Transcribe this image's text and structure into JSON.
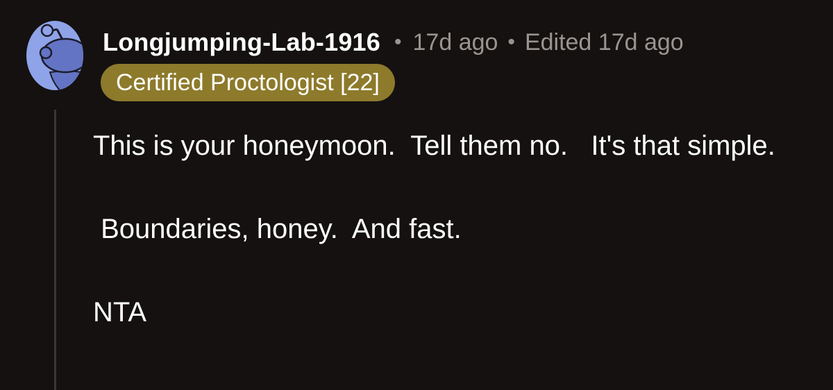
{
  "comment": {
    "username": "Longjumping-Lab-1916",
    "separator": "•",
    "timestamp": "17d ago",
    "edited": "Edited 17d ago",
    "flair": "Certified Proctologist [22]",
    "paragraphs": [
      "This is your honeymoon.  Tell them no.   It's that simple.",
      " Boundaries, honey.  And fast.",
      "NTA"
    ]
  },
  "colors": {
    "background": "#141110",
    "flair": "#8d7a2b",
    "avatar": "#8fa3e8",
    "meta_text": "#9a9490"
  },
  "icons": {
    "avatar": "snoo-avatar-icon"
  }
}
